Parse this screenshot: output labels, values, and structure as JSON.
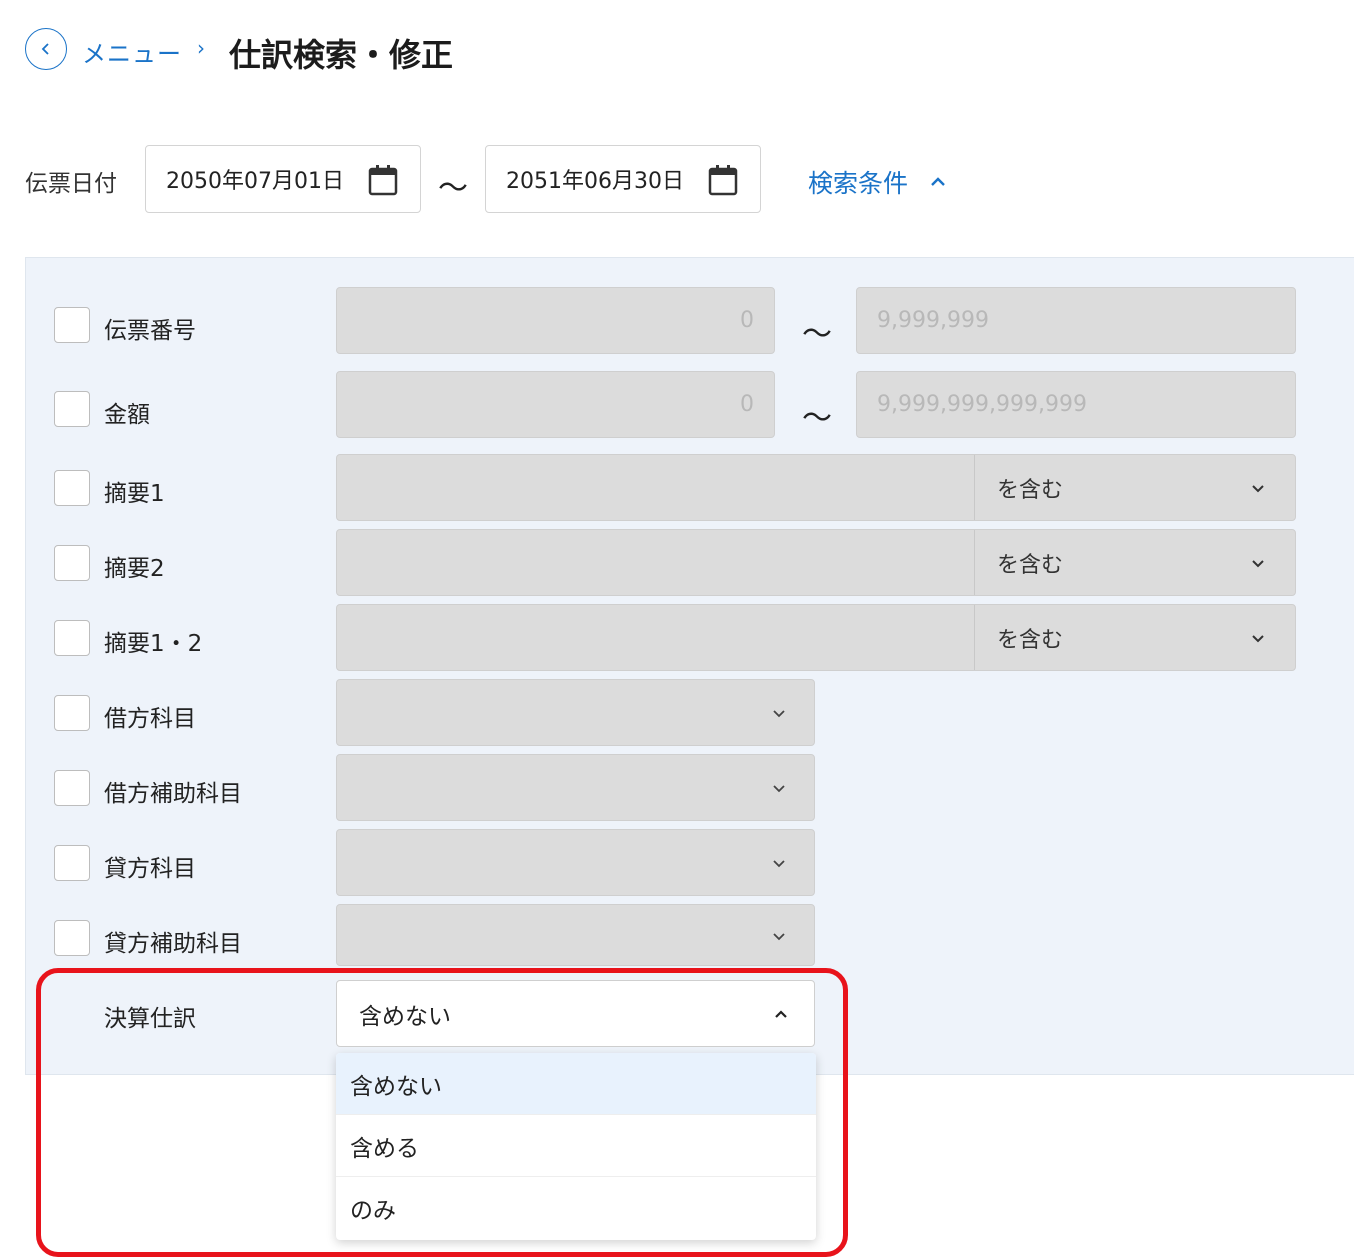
{
  "header": {
    "back_icon": "chevron-left-icon",
    "menu_label": "メニュー",
    "separator": "›",
    "title": "仕訳検索・修正"
  },
  "date_filter": {
    "label": "伝票日付",
    "from": "2050年07月01日",
    "to": "2051年06月30日",
    "range_sep": "〜",
    "calendar_icon": "calendar-icon"
  },
  "search_toggle": {
    "label": "検索条件",
    "icon": "chevron-up-icon"
  },
  "conditions": {
    "slip_number": {
      "label": "伝票番号",
      "from_placeholder": "0",
      "to_placeholder": "9,999,999",
      "range_sep": "〜"
    },
    "amount": {
      "label": "金額",
      "from_placeholder": "0",
      "to_placeholder": "9,999,999,999,999",
      "range_sep": "〜"
    },
    "memo1": {
      "label": "摘要1",
      "match": "を含む"
    },
    "memo2": {
      "label": "摘要2",
      "match": "を含む"
    },
    "memo12": {
      "label": "摘要1・2",
      "match": "を含む"
    },
    "debit_account": {
      "label": "借方科目"
    },
    "debit_sub_account": {
      "label": "借方補助科目"
    },
    "credit_account": {
      "label": "貸方科目"
    },
    "credit_sub_account": {
      "label": "貸方補助科目"
    }
  },
  "closing_entry": {
    "label": "決算仕訳",
    "selected": "含めない",
    "options": [
      "含めない",
      "含める",
      "のみ"
    ]
  },
  "colors": {
    "accent": "#1a73c8",
    "highlight_border": "#e8131b",
    "panel_bg": "#eef3fa",
    "selected_option_bg": "#e8f2fd"
  }
}
